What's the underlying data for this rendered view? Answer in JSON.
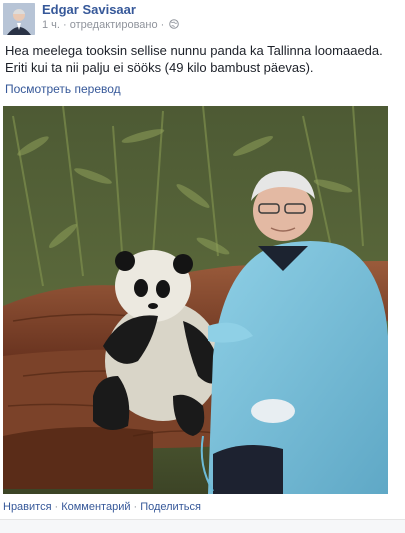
{
  "post": {
    "author": "Edgar Savisaar",
    "time": "1 ч.",
    "edited": "отредактировано",
    "text": "Hea meelega tooksin sellise nunnu panda ka Tallinna loomaaeda. Eriti kui ta nii palju ei sööks (49 kilo bambust päevas).",
    "translate_link": "Посмотреть перевод",
    "photo_alt": "photo"
  },
  "actions": {
    "like": "Нравится",
    "comment": "Комментарий",
    "share": "Поделиться",
    "separator": "·"
  },
  "colors": {
    "link": "#365899",
    "meta": "#90949c",
    "text": "#1d2129"
  },
  "icons": {
    "audience": "globe-icon"
  }
}
